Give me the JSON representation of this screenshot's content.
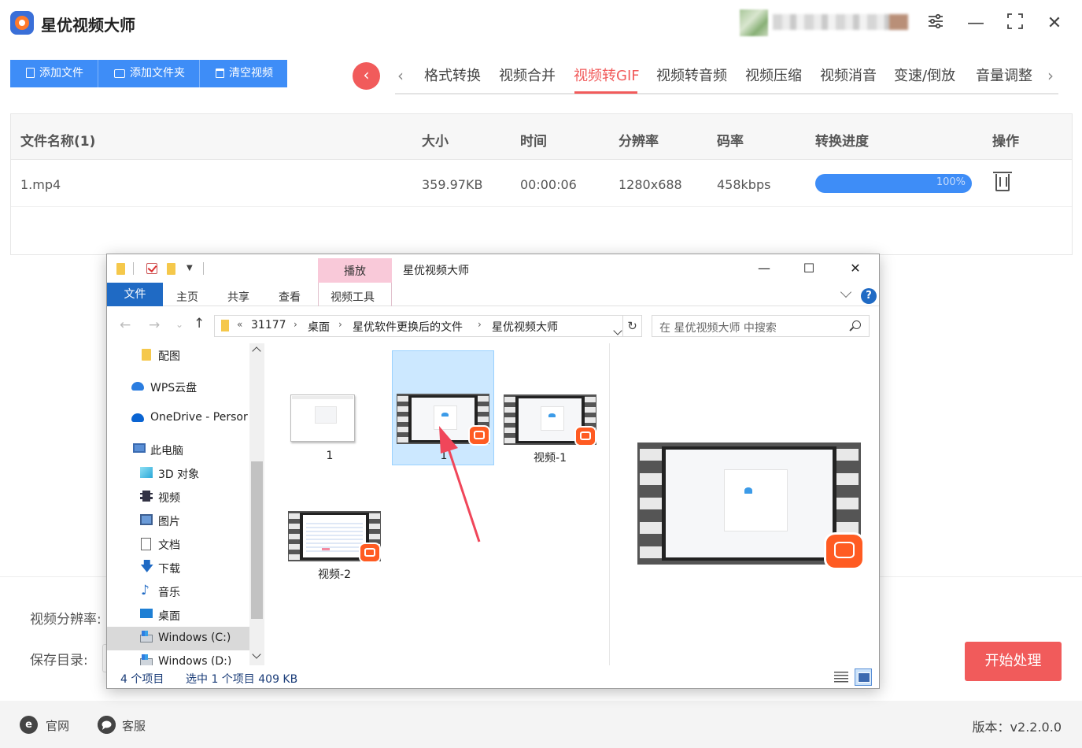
{
  "app": {
    "title": "星优视频大师"
  },
  "toolbar": {
    "add_file": "添加文件",
    "add_folder": "添加文件夹",
    "clear": "清空视频"
  },
  "tabs": {
    "back_glyph": "‹",
    "prev_glyph": "‹",
    "next_glyph": "›",
    "items": [
      "格式转换",
      "视频合并",
      "视频转GIF",
      "视频转音频",
      "视频压缩",
      "视频消音",
      "变速/倒放",
      "音量调整"
    ],
    "active_index": 2
  },
  "table": {
    "headers": [
      "文件名称(1)",
      "大小",
      "时间",
      "分辨率",
      "码率",
      "转换进度",
      "操作"
    ],
    "rows": [
      {
        "name": "1.mp4",
        "size": "359.97KB",
        "duration": "00:00:06",
        "resolution": "1280x688",
        "bitrate": "458kbps",
        "progress_text": "100%",
        "progress": 1.0
      }
    ]
  },
  "settings": {
    "resolution_label": "视频分辨率:",
    "save_dir_label": "保存目录:",
    "start_button": "开始处理"
  },
  "footer": {
    "website_icon": "e",
    "website": "官网",
    "service": "客服",
    "version": "版本：v2.2.0.0"
  },
  "explorer": {
    "title": "星优视频大师",
    "context_tab_group": "播放",
    "ribbon_tabs": [
      "文件",
      "主页",
      "共享",
      "查看",
      "视频工具"
    ],
    "help": "?",
    "breadcrumb": [
      "31177",
      "桌面",
      "星优软件更换后的文件",
      "星优视频大师"
    ],
    "breadcrumb_prefix": "«",
    "search_placeholder": "在 星优视频大师 中搜索",
    "nav_items": [
      {
        "label": "配图",
        "icon": "folder-icon"
      },
      {
        "label": "WPS云盘",
        "icon": "cloud-icon"
      },
      {
        "label": "OneDrive - Persor",
        "icon": "onedrive-icon"
      },
      {
        "label": "此电脑",
        "icon": "computer-icon"
      },
      {
        "label": "3D 对象",
        "icon": "cube-icon"
      },
      {
        "label": "视频",
        "icon": "film-icon"
      },
      {
        "label": "图片",
        "icon": "picture-icon"
      },
      {
        "label": "文档",
        "icon": "document-icon"
      },
      {
        "label": "下载",
        "icon": "download-icon"
      },
      {
        "label": "音乐",
        "icon": "music-icon"
      },
      {
        "label": "桌面",
        "icon": "desktop-icon"
      },
      {
        "label": "Windows (C:)",
        "icon": "drive-icon"
      },
      {
        "label": "Windows (D:)",
        "icon": "drive-icon"
      }
    ],
    "selected_nav": "Windows (C:)",
    "files": [
      {
        "label": "1",
        "kind": "image"
      },
      {
        "label": "1",
        "kind": "video",
        "selected": true
      },
      {
        "label": "视频-1",
        "kind": "video"
      },
      {
        "label": "视频-2",
        "kind": "video-list"
      }
    ],
    "status": {
      "count": "4 个项目",
      "selection": "选中 1 个项目  409 KB"
    },
    "icons": {
      "minimize": "—",
      "maximize": "☐",
      "close": "✕",
      "up": "↑",
      "back": "←",
      "forward": "→",
      "recent": "⌄",
      "refresh": "↻"
    }
  },
  "window": {
    "settings_icon": "⚙",
    "minimize": "—",
    "maximize": "⛶",
    "close": "✕"
  },
  "colors": {
    "accent_blue": "#3e8df7",
    "accent_red": "#f15b5b",
    "explorer_blue": "#1f6ac4",
    "badge_orange": "#ff5b22"
  }
}
